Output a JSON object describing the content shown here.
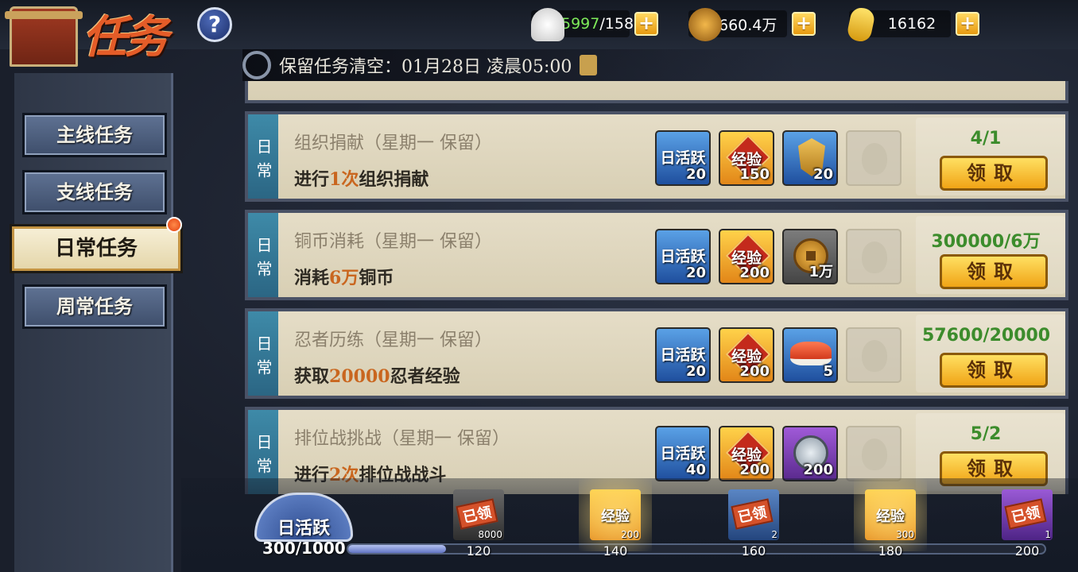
{
  "header": {
    "title": "任务",
    "help": "?",
    "resources": [
      {
        "icon": "onigiri-icon",
        "value_current": "5997",
        "value_rest": "/158"
      },
      {
        "icon": "copper-coin-icon",
        "value": "660.4万"
      },
      {
        "icon": "gold-ingot-icon",
        "value": "16162"
      }
    ],
    "plus": "+"
  },
  "notice": {
    "text": "保留任务清空：01月28日 凌晨05:00"
  },
  "sidebar": {
    "items": [
      {
        "label": "主线任务"
      },
      {
        "label": "支线任务"
      },
      {
        "label": "日常任务"
      },
      {
        "label": "周常任务"
      }
    ]
  },
  "tasks": [
    {
      "tag": "日常",
      "name": "组织捐献（星期一 保留）",
      "desc_pre": "进行",
      "desc_hl": "1次",
      "desc_post": "组织捐献",
      "rewards": [
        {
          "type": "daily-activity",
          "label": "日活跃",
          "qty": "20"
        },
        {
          "type": "exp",
          "label": "经验",
          "qty": "150"
        },
        {
          "type": "badge",
          "label": "",
          "qty": "20"
        }
      ],
      "progress": "4/1",
      "claim": "领取"
    },
    {
      "tag": "日常",
      "name": "铜币消耗（星期一 保留）",
      "desc_pre": "消耗",
      "desc_hl": "6万",
      "desc_post": "铜币",
      "rewards": [
        {
          "type": "daily-activity",
          "label": "日活跃",
          "qty": "20"
        },
        {
          "type": "exp",
          "label": "经验",
          "qty": "200"
        },
        {
          "type": "coin",
          "label": "",
          "qty": "1万"
        }
      ],
      "progress": "300000/6万",
      "claim": "领取"
    },
    {
      "tag": "日常",
      "name": "忍者历练（星期一 保留）",
      "desc_pre": "获取",
      "desc_hl": "20000",
      "desc_post": "忍者经验",
      "rewards": [
        {
          "type": "daily-activity",
          "label": "日活跃",
          "qty": "20"
        },
        {
          "type": "exp",
          "label": "经验",
          "qty": "200"
        },
        {
          "type": "sushi",
          "label": "",
          "qty": "5"
        }
      ],
      "progress": "57600/20000",
      "claim": "领取"
    },
    {
      "tag": "日常",
      "name": "排位战挑战（星期一 保留）",
      "desc_pre": "进行",
      "desc_hl": "2次",
      "desc_post": "排位战战斗",
      "rewards": [
        {
          "type": "daily-activity",
          "label": "日活跃",
          "qty": "40"
        },
        {
          "type": "exp",
          "label": "经验",
          "qty": "200"
        },
        {
          "type": "medal",
          "label": "",
          "qty": "200"
        }
      ],
      "progress": "5/2",
      "claim": "领取"
    }
  ],
  "activity": {
    "label": "日活跃",
    "total": "300/1000",
    "fill_fraction": 0.14,
    "milestones": [
      {
        "value": "120",
        "kind": "claimed",
        "stamp": "已领",
        "qty": "8000"
      },
      {
        "value": "140",
        "kind": "exp",
        "label": "经验",
        "qty": "200"
      },
      {
        "value": "160",
        "kind": "claimed",
        "stamp": "已领",
        "qty": "2"
      },
      {
        "value": "180",
        "kind": "exp",
        "label": "经验",
        "qty": "300"
      },
      {
        "value": "200",
        "kind": "claimed",
        "stamp": "已领",
        "qty": "1"
      }
    ]
  },
  "colors": {
    "accent_gold": "#f0a416",
    "progress_green": "#3c8c2c",
    "highlight_orange": "#c9661f",
    "tag_teal": "#3e8aa8"
  }
}
